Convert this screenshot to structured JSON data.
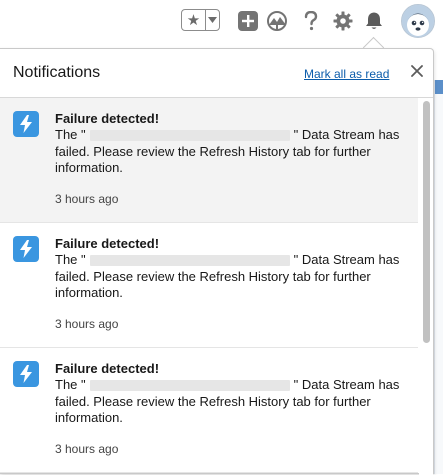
{
  "header": {
    "icons": [
      "star-icon",
      "chevron-down-icon",
      "add-icon",
      "trailhead-icon",
      "help-icon",
      "gear-icon",
      "bell-icon",
      "avatar"
    ]
  },
  "panel": {
    "title": "Notifications",
    "mark_all_label": "Mark all as read",
    "close_icon": "close-icon"
  },
  "notifications": [
    {
      "title": "Failure detected!",
      "body_prefix": "The \"",
      "body_suffix": "\" Data Stream has failed. Please review the Refresh History tab for further information.",
      "time": "3 hours ago",
      "unread": true
    },
    {
      "title": "Failure detected!",
      "body_prefix": "The \"",
      "body_suffix": "\" Data Stream has failed. Please review the Refresh History tab for further information.",
      "time": "3 hours ago",
      "unread": false
    },
    {
      "title": "Failure detected!",
      "body_prefix": "The \"",
      "body_suffix": "\" Data Stream has failed. Please review the Refresh History tab for further information.",
      "time": "3 hours ago",
      "unread": false
    }
  ],
  "colors": {
    "accent": "#3a96e0",
    "link": "#0b5cab",
    "unread_bg": "#f3f3f3"
  }
}
